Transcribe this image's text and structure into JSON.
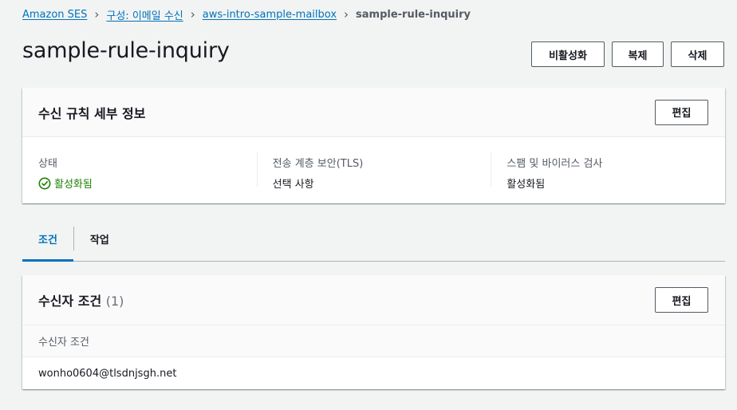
{
  "breadcrumb": {
    "items": [
      "Amazon SES",
      "구성: 이메일 수신",
      "aws-intro-sample-mailbox"
    ],
    "current": "sample-rule-inquiry"
  },
  "page": {
    "title": "sample-rule-inquiry",
    "actions": {
      "disable": "비활성화",
      "copy": "복제",
      "delete": "삭제"
    }
  },
  "details": {
    "title": "수신 규칙 세부 정보",
    "edit_label": "편집",
    "fields": [
      {
        "label": "상태",
        "value": "활성화됨"
      },
      {
        "label": "전송 계층 보안(TLS)",
        "value": "선택 사항"
      },
      {
        "label": "스팸 및 바이러스 검사",
        "value": "활성화됨"
      }
    ]
  },
  "tabs": [
    "조건",
    "작업"
  ],
  "recipients": {
    "title": "수신자 조건",
    "count": "(1)",
    "edit_label": "편집",
    "column": "수신자 조건",
    "rows": [
      "wonho0604@tlsdnjsgh.net"
    ]
  },
  "colors": {
    "link": "#0073bb",
    "success": "#1d8102",
    "background": "#f2f3f3"
  }
}
